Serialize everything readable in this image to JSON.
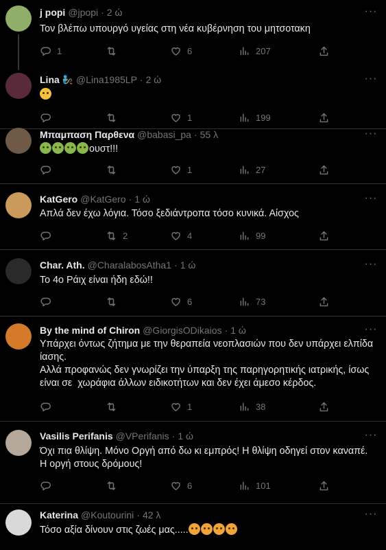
{
  "tweets": [
    {
      "name": "j popi",
      "handle": "@jpopi",
      "time": "2 ώ",
      "text": "Τον βλέπω υπουργό υγείας στη νέα κυβέρνηση του μητσοτακη",
      "reply": "1",
      "retweet": "",
      "like": "6",
      "views": "207",
      "avatar_color": "#8fae6a"
    },
    {
      "name": "Lina",
      "badge": "🧞",
      "handle": "@Lina1985LP",
      "time": "2 ώ",
      "text": "",
      "reply": "",
      "retweet": "",
      "like": "1",
      "views": "199",
      "avatar_color": "#5a2a3a"
    },
    {
      "name": "Μπαμπαση Παρθενα",
      "handle": "@babasi_pa",
      "time": "55 λ",
      "text": "ουστ!!!",
      "reply": "",
      "retweet": "",
      "like": "1",
      "views": "27",
      "avatar_color": "#6f5a48"
    },
    {
      "name": "KatGero",
      "handle": "@KatGero",
      "time": "1 ώ",
      "text": "Απλά δεν έχω λόγια. Τόσο ξεδιάντροπα τόσο κυνικά. Αίσχος",
      "reply": "",
      "retweet": "2",
      "like": "4",
      "views": "99",
      "avatar_color": "#c99a5b"
    },
    {
      "name": "Char. Ath.",
      "handle": "@CharalabosAtha1",
      "time": "1 ώ",
      "text": "Το 4ο Ράιχ είναι ήδη εδώ!!",
      "reply": "",
      "retweet": "",
      "like": "6",
      "views": "73",
      "avatar_color": "#2a2a2a"
    },
    {
      "name": "By the mind of Chiron",
      "handle": "@GiorgisODikaios",
      "time": "1 ώ",
      "text": "Υπάρχει όντως ζήτημα με την θεραπεία νεοπλασιών που δεν υπάρχει ελπίδα ίασης.\nΑλλά προφανώς δεν γνωρίζει την ύπαρξη της παρηγορητικής ιατρικής, ίσως είναι σε  χωράφια άλλων ειδικοτήτων και δεν έχει άμεσο κέρδος.",
      "reply": "",
      "retweet": "",
      "like": "1",
      "views": "38",
      "avatar_color": "#d47a2a"
    },
    {
      "name": "Vasilis Perifanis",
      "handle": "@VPerifanis",
      "time": "1 ώ",
      "text": "Όχι πια θλίψη. Μόνο Οργή από δω κι εμπρός! Η θλίψη οδηγεί στον καναπέ. Η οργή στους δρόμους!",
      "reply": "",
      "retweet": "",
      "like": "6",
      "views": "101",
      "avatar_color": "#b5a79a"
    },
    {
      "name": "Katerina",
      "handle": "@Koutourini",
      "time": "42 λ",
      "text": "Τόσο αξία δίνουν στις ζωές μας.....",
      "avatar_color": "#d9d9d9"
    }
  ],
  "icons": {
    "reply": "reply-icon",
    "retweet": "retweet-icon",
    "like": "heart-icon",
    "views": "views-icon",
    "share": "share-icon",
    "more": "more-icon"
  }
}
